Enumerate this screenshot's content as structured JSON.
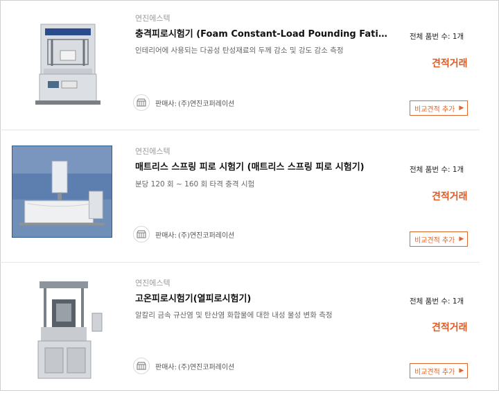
{
  "products": [
    {
      "brand": "연진에스텍",
      "title": "충격피로시험기 (Foam Constant-Load Pounding Fatigue Tester)",
      "description": "인테리어에 사용되는 다공성 탄성재료의 두께 감소 및 강도 감소 측정",
      "seller_label": "판매사:",
      "seller_name": "(주)연진코퍼레이션",
      "count_text": "전체 품번 수: 1개",
      "price_text": "견적거래",
      "compare_label": "비교견적 추가",
      "image_icon": "foam-fatigue-tester-photo"
    },
    {
      "brand": "연진에스텍",
      "title": "매트리스 스프링 피로 시험기 (매트리스 스프링 피로 시험기)",
      "description": "분당 120 회 ~ 160 회 타격 충격 시험",
      "seller_label": "판매사:",
      "seller_name": "(주)연진코퍼레이션",
      "count_text": "전체 품번 수: 1개",
      "price_text": "견적거래",
      "compare_label": "비교견적 추가",
      "image_icon": "mattress-tester-photo"
    },
    {
      "brand": "연진에스텍",
      "title": "고온피로시험기(열피로시험기)",
      "description": "알칼리 금속 규산염 및 탄산염 화합물에 대한 내성 물성 변화 측정",
      "seller_label": "판매사:",
      "seller_name": "(주)연진코퍼레이션",
      "count_text": "전체 품번 수: 1개",
      "price_text": "견적거래",
      "compare_label": "비교견적 추가",
      "image_icon": "thermal-fatigue-tester-photo"
    }
  ],
  "colors": {
    "accent": "#e05a1f",
    "button_border": "#e0662a",
    "brand_gray": "#9a9a9a",
    "separator": "#e6e6e6"
  },
  "icons": {
    "shop": "shop-icon",
    "arrow": "chevron-right-icon"
  }
}
